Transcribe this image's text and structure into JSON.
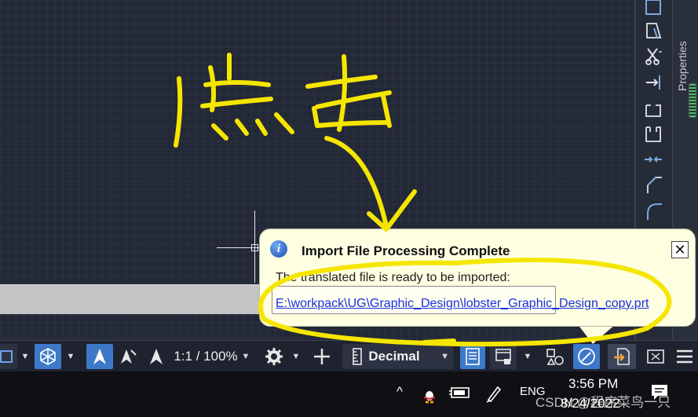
{
  "balloon": {
    "title": "Import File Processing Complete",
    "message": "The translated file is ready to be imported:",
    "file_link": "E:\\workpack\\UG\\Graphic_Design\\lobster_Graphic_Design_copy.prt",
    "close_symbol": "✕",
    "info_symbol": "i"
  },
  "status_bar": {
    "scale": "1:1 / 100%",
    "units": "Decimal",
    "icons": [
      "model-space-icon",
      "isometric-view-icon",
      "annotation-scale-icon",
      "annotation-visibility-icon",
      "annotation-autoscale-icon",
      "gear-icon",
      "plus-icon",
      "units-ruler-icon",
      "quick-properties-icon",
      "lock-ui-icon",
      "isolate-objects-icon",
      "hardware-acceleration-icon",
      "import-file-notification-icon",
      "clean-screen-icon",
      "customization-menu-icon"
    ],
    "active_color": "#3e79c9"
  },
  "properties_panel": {
    "label": "Properties"
  },
  "taskbar": {
    "show_hidden_icon": "^",
    "language": "ENG",
    "time": "3:56 PM",
    "date": "8/24/2022",
    "tray_icons": [
      "qq-penguin-icon",
      "battery-icon",
      "pen-icon",
      "notification-icon"
    ]
  },
  "overlay": {
    "watermark": "CSDN @程序菜鸟一只",
    "annotation_color": "#f5e600"
  }
}
